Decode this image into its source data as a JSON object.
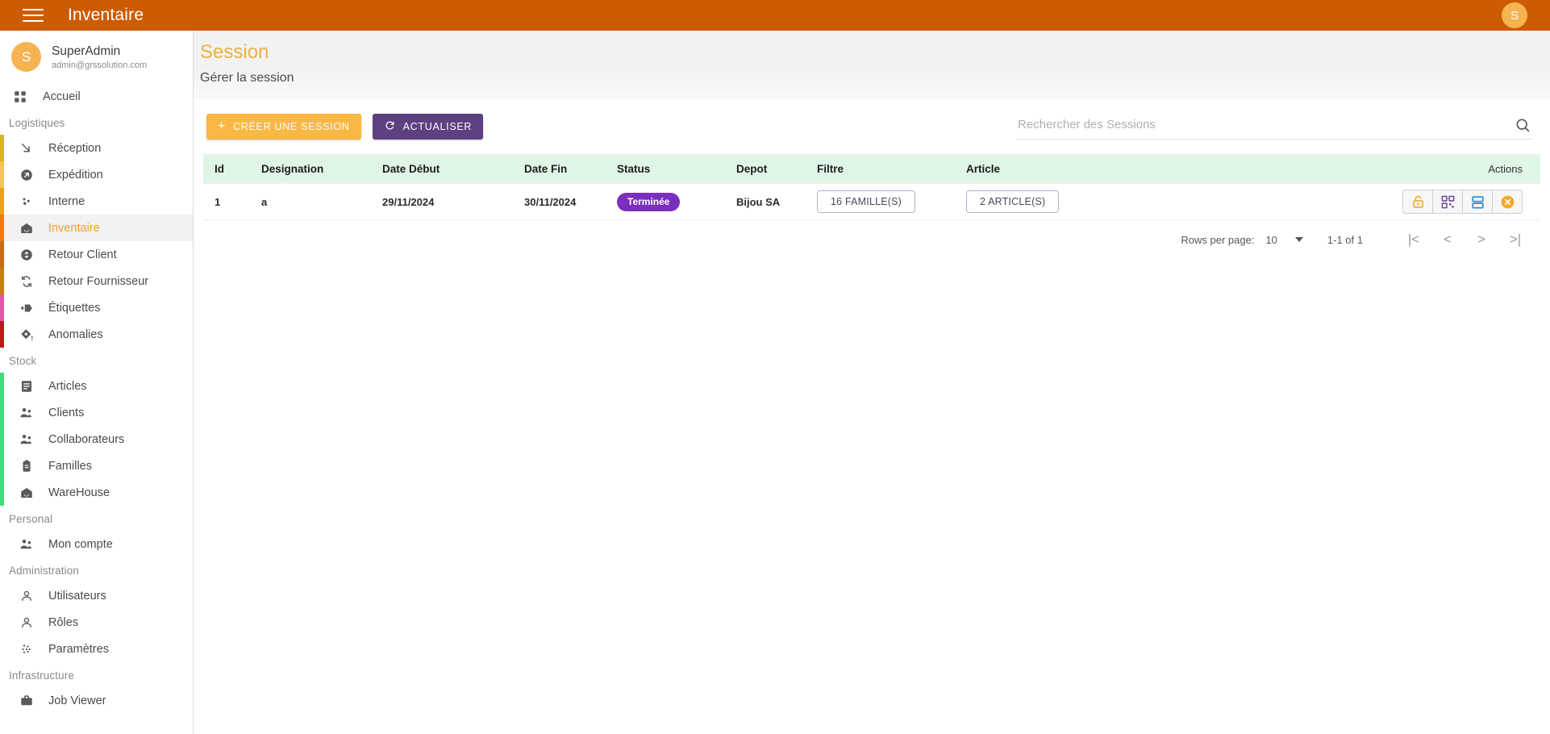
{
  "topbar": {
    "menu_icon": "hamburger-icon",
    "title": "Inventaire",
    "avatar_initial": "S",
    "accent_color": "#cc5c04"
  },
  "sidebar": {
    "profile": {
      "initial": "S",
      "name": "SuperAdmin",
      "email": "admin@grssolution.com"
    },
    "home": {
      "label": "Accueil",
      "icon": "dashboard-grid-icon"
    },
    "groups": [
      {
        "label": "Logistiques",
        "items": [
          {
            "label": "Réception",
            "icon": "arrow-down-right-icon",
            "edge_color": "#d9b61f",
            "active": false
          },
          {
            "label": "Expédition",
            "icon": "arrow-up-right-circle-icon",
            "edge_color": "#f6c45a",
            "active": false
          },
          {
            "label": "Interne",
            "icon": "dots-scatter-icon",
            "edge_color": "#eda020",
            "active": false
          },
          {
            "label": "Inventaire",
            "icon": "warehouse-icon",
            "edge_color": "#ef7a1a",
            "active": true
          },
          {
            "label": "Retour Client",
            "icon": "return-circle-icon",
            "edge_color": "#c96a12",
            "active": false
          },
          {
            "label": "Retour Fournisseur",
            "icon": "refresh-cycle-icon",
            "edge_color": "#c87d10",
            "active": false
          },
          {
            "label": "Étiquettes",
            "icon": "tag-plus-icon",
            "edge_color": "#e055a8",
            "active": false
          },
          {
            "label": "Anomalies",
            "icon": "alert-diamond-icon",
            "edge_color": "#c01818",
            "active": false
          }
        ]
      },
      {
        "label": "Stock",
        "items": [
          {
            "label": "Articles",
            "icon": "article-list-icon",
            "edge_color": "#45d97a",
            "active": false
          },
          {
            "label": "Clients",
            "icon": "people-icon",
            "edge_color": "#45d97a",
            "active": false
          },
          {
            "label": "Collaborateurs",
            "icon": "people-icon",
            "edge_color": "#45d97a",
            "active": false
          },
          {
            "label": "Familles",
            "icon": "clipboard-icon",
            "edge_color": "#45d97a",
            "active": false
          },
          {
            "label": "WareHouse",
            "icon": "warehouse-icon",
            "edge_color": "#45d97a",
            "active": false
          }
        ]
      },
      {
        "label": "Personal",
        "items": [
          {
            "label": "Mon compte",
            "icon": "people-icon",
            "edge_color": "",
            "active": false
          }
        ]
      },
      {
        "label": "Administration",
        "items": [
          {
            "label": "Utilisateurs",
            "icon": "person-icon",
            "edge_color": "",
            "active": false
          },
          {
            "label": "Rôles",
            "icon": "person-icon",
            "edge_color": "",
            "active": false
          },
          {
            "label": "Paramètres",
            "icon": "dots-grid-icon",
            "edge_color": "",
            "active": false
          }
        ]
      },
      {
        "label": "Infrastructure",
        "items": [
          {
            "label": "Job Viewer",
            "icon": "briefcase-icon",
            "edge_color": "",
            "active": false
          }
        ]
      }
    ]
  },
  "page": {
    "title": "Session",
    "subtitle": "Gérer la session",
    "title_color": "#f0b040"
  },
  "toolbar": {
    "create_label": "CRÉER UNE SESSION",
    "create_color": "#f8b843",
    "refresh_label": "ACTUALISER",
    "refresh_color": "#5d4080",
    "refresh_icon": "refresh-icon",
    "plus_icon": "plus-icon"
  },
  "search": {
    "placeholder": "Rechercher des Sessions",
    "value": "",
    "icon": "search-icon"
  },
  "table": {
    "columns": [
      "Id",
      "Designation",
      "Date Début",
      "Date Fin",
      "Status",
      "Depot",
      "Filtre",
      "Article",
      "Actions"
    ],
    "header_bg": "#dff5e6",
    "rows": [
      {
        "id": "1",
        "designation": "a",
        "date_debut": "29/11/2024",
        "date_fin": "30/11/2024",
        "status": "Terminée",
        "status_color": "#7b2fbe",
        "depot": "Bijou SA",
        "filtre": "16 FAMILLE(S)",
        "article": "2 ARTICLE(S)",
        "actions": [
          {
            "name": "unlock-icon",
            "color": "#f0a830"
          },
          {
            "name": "qr-code-icon",
            "color": "#6b4a9e"
          },
          {
            "name": "split-rows-icon",
            "color": "#2b8fe0"
          },
          {
            "name": "close-circle-icon",
            "color": "#f5a623"
          }
        ]
      }
    ]
  },
  "pagination": {
    "rows_per_page_label": "Rows per page:",
    "rows_per_page_value": "10",
    "range": "1-1 of 1",
    "first_icon": "first-page-icon",
    "prev_icon": "previous-page-icon",
    "next_icon": "next-page-icon",
    "last_icon": "last-page-icon"
  }
}
